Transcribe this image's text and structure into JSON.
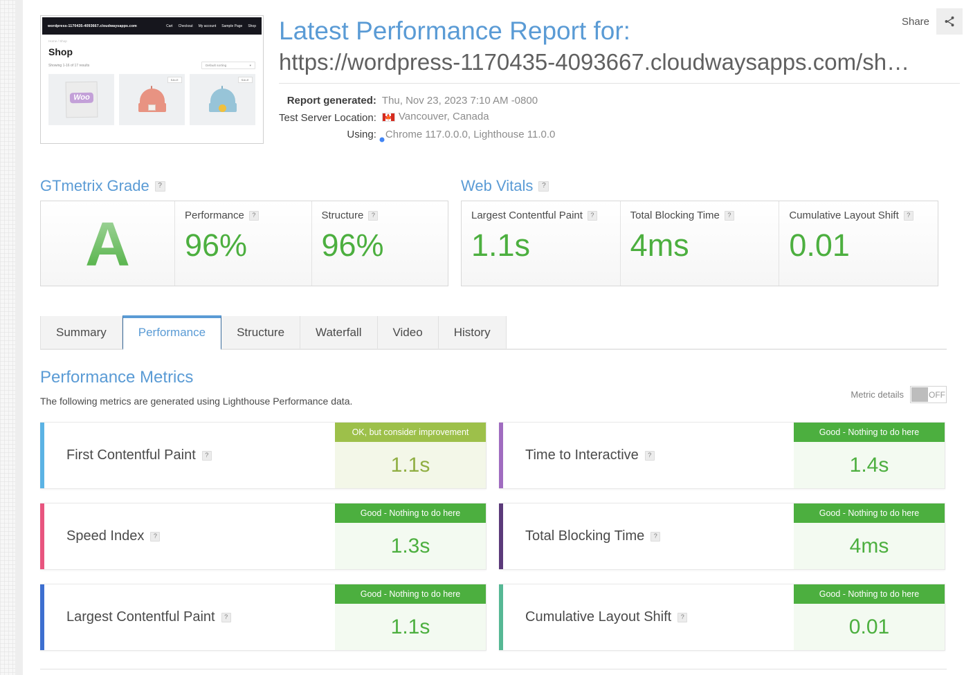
{
  "header": {
    "share_label": "Share",
    "share_icon": "share-icon",
    "title": "Latest Performance Report for:",
    "url": "https://wordpress-1170435-4093667.cloudwaysapps.com/sh…",
    "meta": [
      {
        "key": "Report generated:",
        "value": "Thu, Nov 23, 2023 7:10 AM -0800",
        "icon": ""
      },
      {
        "key": "Test Server Location:",
        "value": "Vancouver, Canada",
        "icon": "canada-flag-icon"
      },
      {
        "key": "Using:",
        "value": "Chrome 117.0.0.0, Lighthouse 11.0.0",
        "icon": "chrome-icon"
      }
    ]
  },
  "thumbnail": {
    "site_title": "wordpress-1170435-4093667.cloudwaysapps.com",
    "nav_links": [
      "Cart",
      "Checkout",
      "My account",
      "Sample Page",
      "Shop"
    ],
    "breadcrumb": "Home / Shop",
    "page_heading": "Shop",
    "results_text": "Showing 1-16 of 17 results",
    "sort_value": "Default sorting",
    "sale_badge": "SALE",
    "products": [
      {
        "name": "woo-album",
        "badge": "",
        "logo_text": "Woo"
      },
      {
        "name": "orange-beanie",
        "badge": "SALE",
        "logo_text": ""
      },
      {
        "name": "blue-beanie",
        "badge": "SALE",
        "logo_text": ""
      }
    ]
  },
  "gtmetrix_grade": {
    "title": "GTmetrix Grade",
    "grade": "A",
    "items": [
      {
        "label": "Performance",
        "value": "96%"
      },
      {
        "label": "Structure",
        "value": "96%"
      }
    ]
  },
  "web_vitals": {
    "title": "Web Vitals",
    "items": [
      {
        "label": "Largest Contentful Paint",
        "value": "1.1s"
      },
      {
        "label": "Total Blocking Time",
        "value": "4ms"
      },
      {
        "label": "Cumulative Layout Shift",
        "value": "0.01"
      }
    ]
  },
  "tabs": [
    {
      "label": "Summary",
      "active": false
    },
    {
      "label": "Performance",
      "active": true
    },
    {
      "label": "Structure",
      "active": false
    },
    {
      "label": "Waterfall",
      "active": false
    },
    {
      "label": "Video",
      "active": false
    },
    {
      "label": "History",
      "active": false
    }
  ],
  "metrics_section": {
    "title": "Performance Metrics",
    "subtitle": "The following metrics are generated using Lighthouse Performance data.",
    "toggle_label": "Metric details",
    "toggle_state": "OFF",
    "cards": [
      {
        "name": "First Contentful Paint",
        "banner": "OK, but consider improvement",
        "value": "1.1s",
        "grade": "ok",
        "accent": "#5bb3e4"
      },
      {
        "name": "Time to Interactive",
        "banner": "Good - Nothing to do here",
        "value": "1.4s",
        "grade": "good",
        "accent": "#a06cc0"
      },
      {
        "name": "Speed Index",
        "banner": "Good - Nothing to do here",
        "value": "1.3s",
        "grade": "good",
        "accent": "#e8557f"
      },
      {
        "name": "Total Blocking Time",
        "banner": "Good - Nothing to do here",
        "value": "4ms",
        "grade": "good",
        "accent": "#5b3a7a"
      },
      {
        "name": "Largest Contentful Paint",
        "banner": "Good - Nothing to do here",
        "value": "1.1s",
        "grade": "good",
        "accent": "#3d6fd0"
      },
      {
        "name": "Cumulative Layout Shift",
        "banner": "Good - Nothing to do here",
        "value": "0.01",
        "grade": "good",
        "accent": "#56b894"
      }
    ]
  },
  "help_glyph": "?",
  "colors": {
    "brand_blue": "#5a9bd5",
    "good_green": "#4caf3f",
    "ok_green": "#9dc04a"
  }
}
